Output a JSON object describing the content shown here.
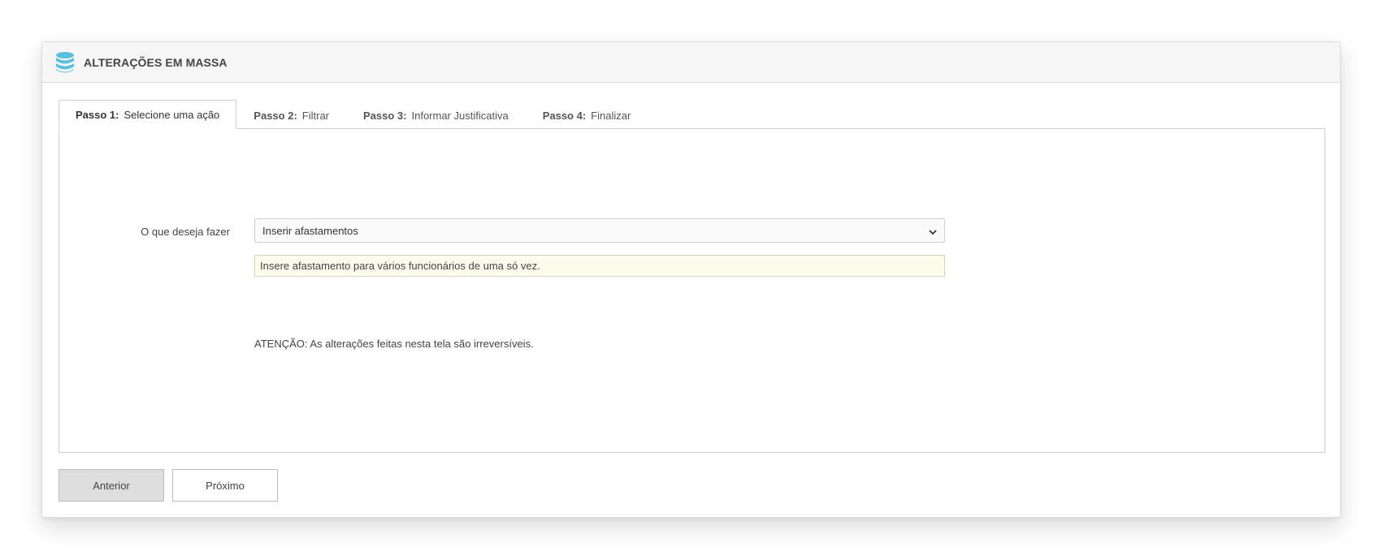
{
  "panel": {
    "title": "ALTERAÇÕES EM MASSA",
    "icon": "database-icon",
    "icon_color": "#5bc0de"
  },
  "tabs": [
    {
      "step": "Passo 1:",
      "label": "Selecione uma ação",
      "active": true
    },
    {
      "step": "Passo 2:",
      "label": "Filtrar",
      "active": false
    },
    {
      "step": "Passo 3:",
      "label": "Informar Justificativa",
      "active": false
    },
    {
      "step": "Passo 4:",
      "label": "Finalizar",
      "active": false
    }
  ],
  "form": {
    "action_label": "O que deseja fazer",
    "action_selected": "Inserir afastamentos",
    "action_description": "Insere afastamento para vários funcionários de uma só vez.",
    "warning": "ATENÇÃO: As alterações feitas nesta tela são irreversíveis."
  },
  "buttons": {
    "previous": "Anterior",
    "next": "Próximo"
  }
}
